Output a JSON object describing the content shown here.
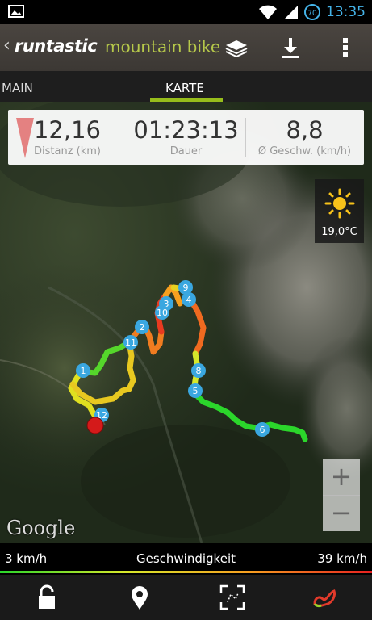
{
  "status_bar": {
    "time": "13:35",
    "battery_level": "70",
    "icons": [
      "image-icon",
      "wifi-icon",
      "signal-icon",
      "battery-icon"
    ]
  },
  "action_bar": {
    "brand": "runtastic",
    "product": "mountain bike",
    "icons": [
      "layers-icon",
      "download-icon",
      "overflow-menu-icon"
    ],
    "accent": "#b6c84a"
  },
  "tabs": [
    {
      "label": "MAIN",
      "active": false
    },
    {
      "label": "KARTE",
      "active": true
    }
  ],
  "stats": [
    {
      "value": "12,16",
      "label": "Distanz (km)"
    },
    {
      "value": "01:23:13",
      "label": "Dauer"
    },
    {
      "value": "8,8",
      "label": "Ø Geschw. (km/h)"
    }
  ],
  "weather": {
    "temperature": "19,0°C",
    "icon": "sun-icon"
  },
  "map": {
    "attribution": "Google",
    "zoom_in": "+",
    "zoom_out": "−",
    "km_markers": [
      "1",
      "2",
      "3",
      "4",
      "5",
      "6",
      "8",
      "9",
      "10",
      "11",
      "12"
    ]
  },
  "speed_legend": {
    "min": "3 km/h",
    "title": "Geschwindigkeit",
    "max": "39 km/h",
    "colors": [
      "#2bd62b",
      "#d6e82b",
      "#f7a020",
      "#e82020"
    ]
  },
  "bottom_bar": {
    "icons": [
      "lock-icon",
      "location-pin-icon",
      "fullscreen-icon",
      "route-icon"
    ]
  }
}
